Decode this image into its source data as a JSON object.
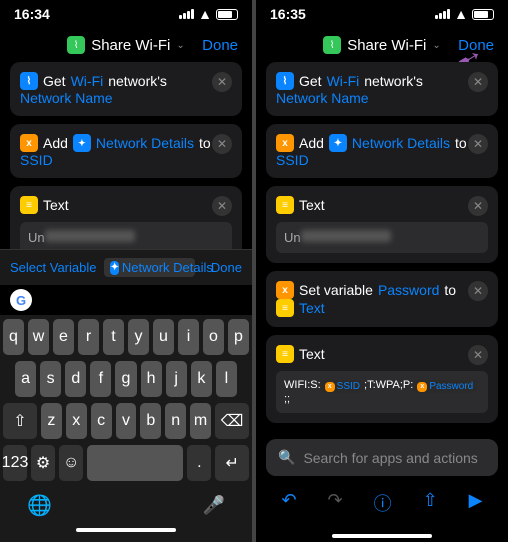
{
  "status": {
    "time_left": "16:34",
    "time_right": "16:35"
  },
  "header": {
    "title": "Share Wi-Fi",
    "done": "Done"
  },
  "actions": {
    "get": "Get",
    "wifi": "Wi-Fi",
    "networks": "network's",
    "netname": "Network Name",
    "add": "Add",
    "netdetails": "Network Details",
    "to": "to",
    "ssid": "SSID",
    "text": "Text",
    "un": "Un",
    "setvar": "Set variable",
    "password": "Password",
    "textvar": "Text",
    "wifistr": "WIFI:S:",
    "ssidchip": "SSID",
    "wpa": ";T:WPA;P:",
    "pwchip": "Password",
    "end": ";;"
  },
  "toolbar": {
    "select": "Select Variable",
    "netdetails": "Network Details",
    "done": "Done"
  },
  "search": {
    "placeholder": "Search for apps and actions"
  },
  "keys": {
    "r1": [
      "q",
      "w",
      "e",
      "r",
      "t",
      "y",
      "u",
      "i",
      "o",
      "p"
    ],
    "r2": [
      "a",
      "s",
      "d",
      "f",
      "g",
      "h",
      "j",
      "k",
      "l"
    ],
    "r3": [
      "z",
      "x",
      "c",
      "v",
      "b",
      "n",
      "m"
    ],
    "num": "123",
    "space": "space",
    "ret": "return"
  }
}
